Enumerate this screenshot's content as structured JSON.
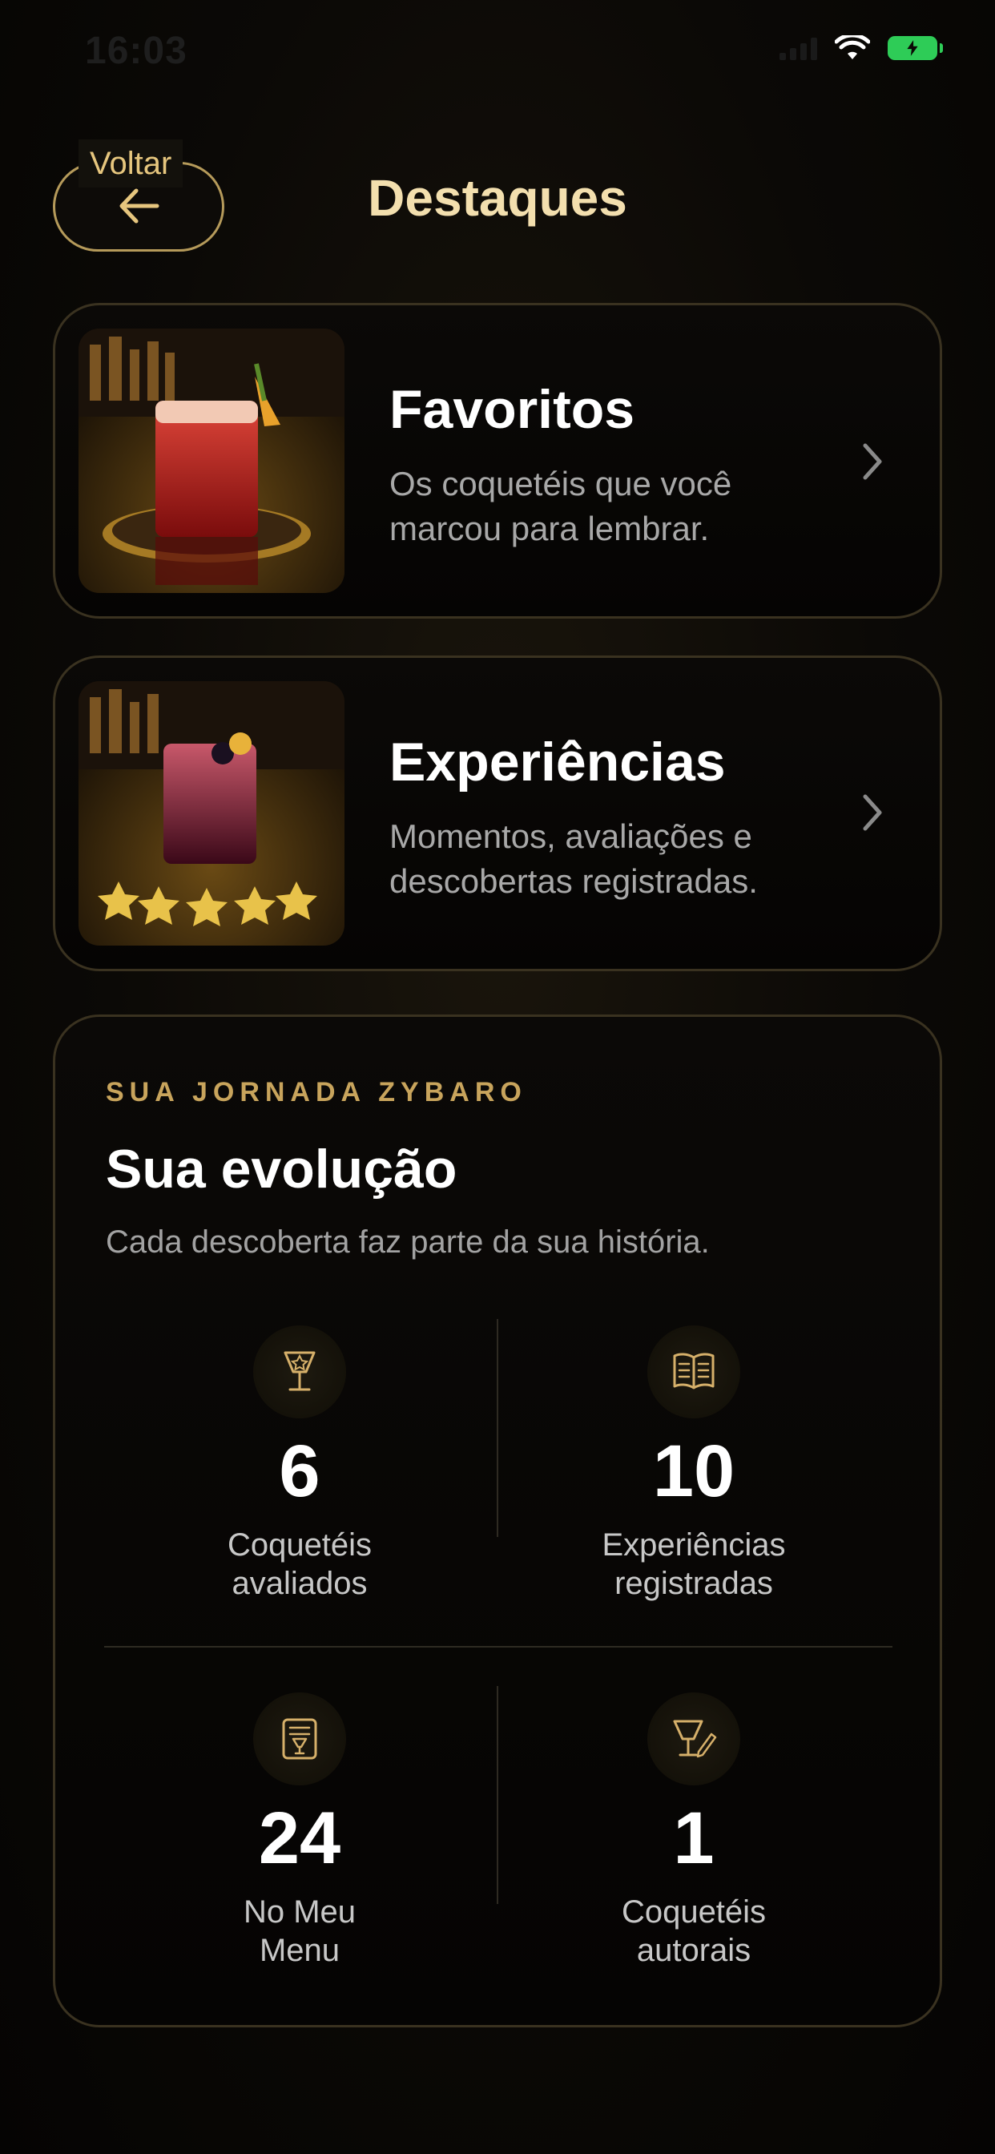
{
  "status_bar": {
    "time": "16:03"
  },
  "header": {
    "back_label": "Voltar",
    "title": "Destaques"
  },
  "cards": [
    {
      "title": "Favoritos",
      "description": "Os coquetéis que você marcou para lembrar."
    },
    {
      "title": "Experiências",
      "description": "Momentos, avaliações e descobertas registradas."
    }
  ],
  "journey": {
    "eyebrow": "SUA JORNADA ZYBARO",
    "title": "Sua evolução",
    "subtitle": "Cada descoberta faz parte da sua história.",
    "stats": [
      {
        "value": "6",
        "label_line1": "Coquetéis",
        "label_line2": "avaliados",
        "icon": "cocktail-star-icon"
      },
      {
        "value": "10",
        "label_line1": "Experiências",
        "label_line2": "registradas",
        "icon": "open-book-icon"
      },
      {
        "value": "24",
        "label_line1": "No Meu",
        "label_line2": "Menu",
        "icon": "menu-card-icon"
      },
      {
        "value": "1",
        "label_line1": "Coquetéis",
        "label_line2": "autorais",
        "icon": "cocktail-pen-icon"
      }
    ]
  },
  "colors": {
    "accent": "#e6c67e",
    "title_gold": "#f3dfae",
    "eyebrow_gold": "#c8a45c",
    "battery": "#2ecc57"
  }
}
